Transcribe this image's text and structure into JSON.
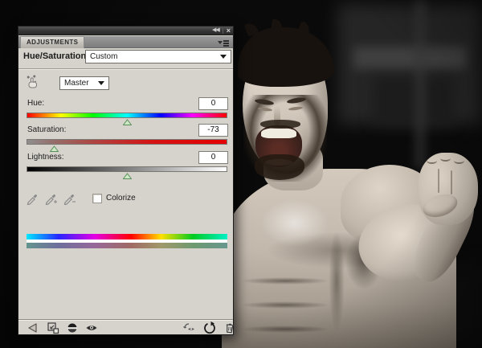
{
  "window": {
    "collapse_icon_glyph": "◀◀",
    "close_icon_glyph": "×"
  },
  "panel": {
    "tab_label": "ADJUSTMENTS",
    "adjustment_name": "Hue/Saturation",
    "preset": {
      "value": "Custom"
    },
    "channel": {
      "value": "Master"
    },
    "sliders": [
      {
        "label": "Hue:",
        "value": "0",
        "marker_pct": 50
      },
      {
        "label": "Saturation:",
        "value": "-73",
        "marker_pct": 13.5
      },
      {
        "label": "Lightness:",
        "value": "0",
        "marker_pct": 50
      }
    ],
    "colorize": {
      "label": "Colorize",
      "checked": false
    },
    "footer_icons": [
      "return-arrow",
      "clip-to-layer",
      "visibility-sphere",
      "eye",
      "view-previous-state",
      "reset",
      "delete-adjustment"
    ]
  },
  "colors": {
    "panel_bg": "#d6d2cc",
    "titlebar": "#3a3a3a",
    "marker_fill": "#cfe9c8",
    "marker_stroke": "#578f57",
    "saturation_red": "#e50000"
  }
}
